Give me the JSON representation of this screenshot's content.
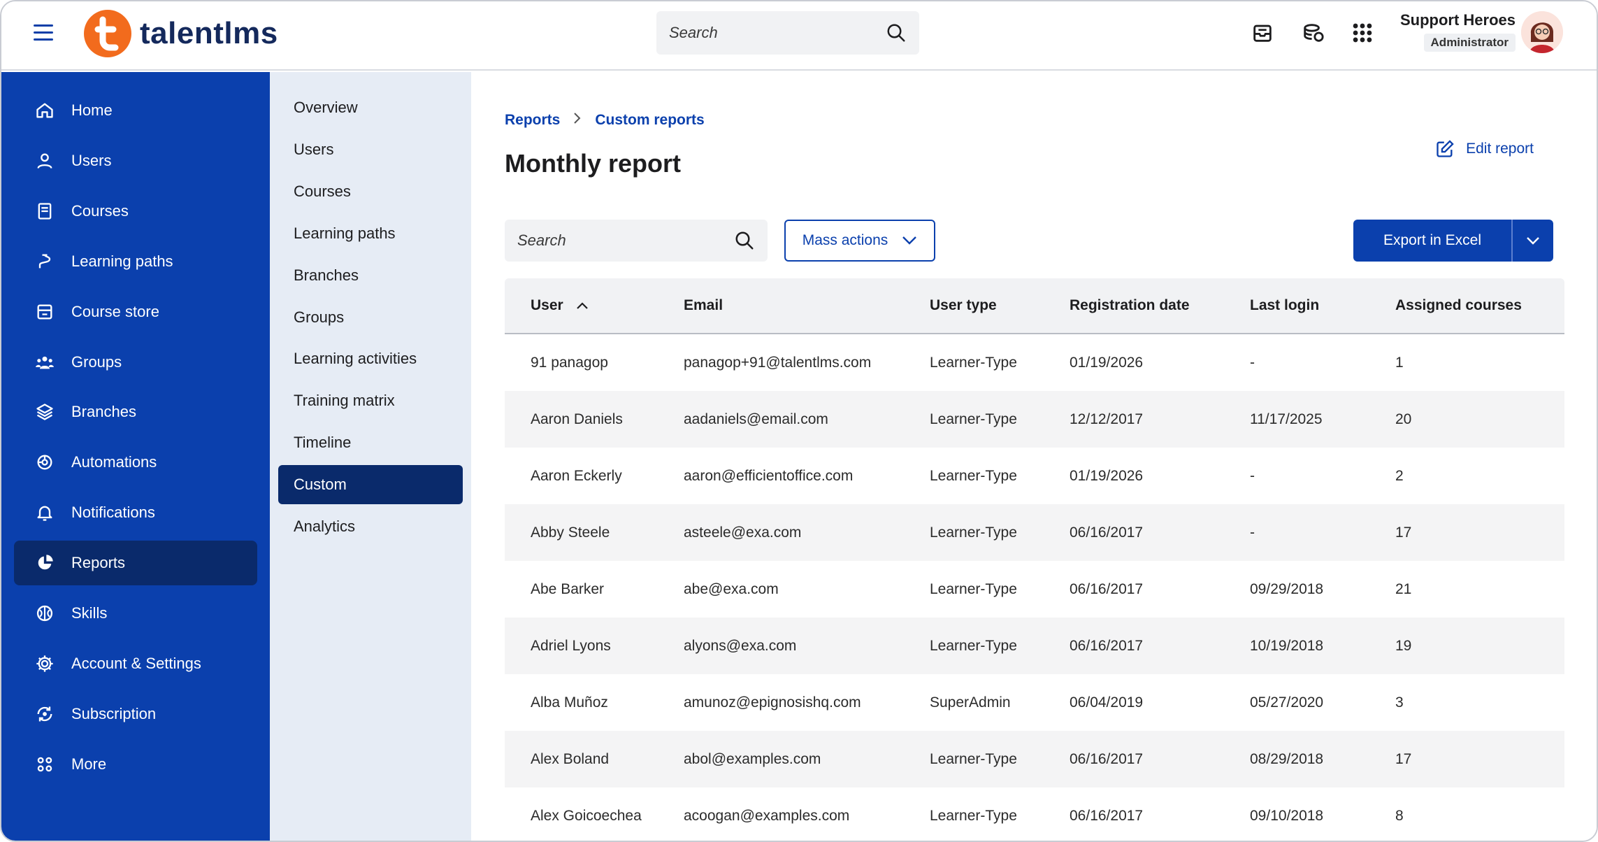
{
  "app": {
    "logo_text": "talentlms",
    "search_placeholder": "Search",
    "user": {
      "name": "Support Heroes",
      "role": "Administrator"
    },
    "icons": [
      "hamburger-icon",
      "inbox-icon",
      "coins-icon",
      "apps-grid-icon",
      "search-icon"
    ]
  },
  "colors": {
    "primary": "#0b40ad",
    "sidebar_active": "#0a2a6b",
    "logo_orange": "#f26b1d",
    "subnav_bg": "#e6ecf5"
  },
  "sidebar": {
    "items": [
      {
        "label": "Home",
        "icon": "home-icon"
      },
      {
        "label": "Users",
        "icon": "user-icon"
      },
      {
        "label": "Courses",
        "icon": "book-icon"
      },
      {
        "label": "Learning paths",
        "icon": "path-icon"
      },
      {
        "label": "Course store",
        "icon": "store-icon"
      },
      {
        "label": "Groups",
        "icon": "groups-icon"
      },
      {
        "label": "Branches",
        "icon": "layers-icon"
      },
      {
        "label": "Automations",
        "icon": "automation-icon"
      },
      {
        "label": "Notifications",
        "icon": "bell-icon"
      },
      {
        "label": "Reports",
        "icon": "pie-chart-icon",
        "active": true
      },
      {
        "label": "Skills",
        "icon": "brain-icon"
      },
      {
        "label": "Account & Settings",
        "icon": "gear-icon"
      },
      {
        "label": "Subscription",
        "icon": "subscription-icon"
      },
      {
        "label": "More",
        "icon": "more-icon"
      }
    ]
  },
  "subnav": {
    "items": [
      "Overview",
      "Users",
      "Courses",
      "Learning paths",
      "Branches",
      "Groups",
      "Learning activities",
      "Training matrix",
      "Timeline",
      "Custom",
      "Analytics"
    ],
    "active": "Custom"
  },
  "main": {
    "breadcrumb": [
      "Reports",
      "Custom reports"
    ],
    "title": "Monthly report",
    "edit_report": "Edit report",
    "search_placeholder": "Search",
    "mass_actions": "Mass actions",
    "export": "Export in Excel",
    "table": {
      "headers": [
        "User",
        "Email",
        "User type",
        "Registration date",
        "Last login",
        "Assigned courses"
      ],
      "rows": [
        [
          "91 panagop",
          "panagop+91@talentlms.com",
          "Learner-Type",
          "01/19/2026",
          "-",
          "1"
        ],
        [
          "Aaron Daniels",
          "aadaniels@email.com",
          "Learner-Type",
          "12/12/2017",
          "11/17/2025",
          "20"
        ],
        [
          "Aaron Eckerly",
          "aaron@efficientoffice.com",
          "Learner-Type",
          "01/19/2026",
          "-",
          "2"
        ],
        [
          "Abby Steele",
          "asteele@exa.com",
          "Learner-Type",
          "06/16/2017",
          "-",
          "17"
        ],
        [
          "Abe Barker",
          "abe@exa.com",
          "Learner-Type",
          "06/16/2017",
          "09/29/2018",
          "21"
        ],
        [
          "Adriel Lyons",
          "alyons@exa.com",
          "Learner-Type",
          "06/16/2017",
          "10/19/2018",
          "19"
        ],
        [
          "Alba Muñoz",
          "amunoz@epignosishq.com",
          "SuperAdmin",
          "06/04/2019",
          "05/27/2020",
          "3"
        ],
        [
          "Alex Boland",
          "abol@examples.com",
          "Learner-Type",
          "06/16/2017",
          "08/29/2018",
          "17"
        ],
        [
          "Alex Goicoechea",
          "acoogan@examples.com",
          "Learner-Type",
          "06/16/2017",
          "09/10/2018",
          "8"
        ]
      ]
    }
  }
}
